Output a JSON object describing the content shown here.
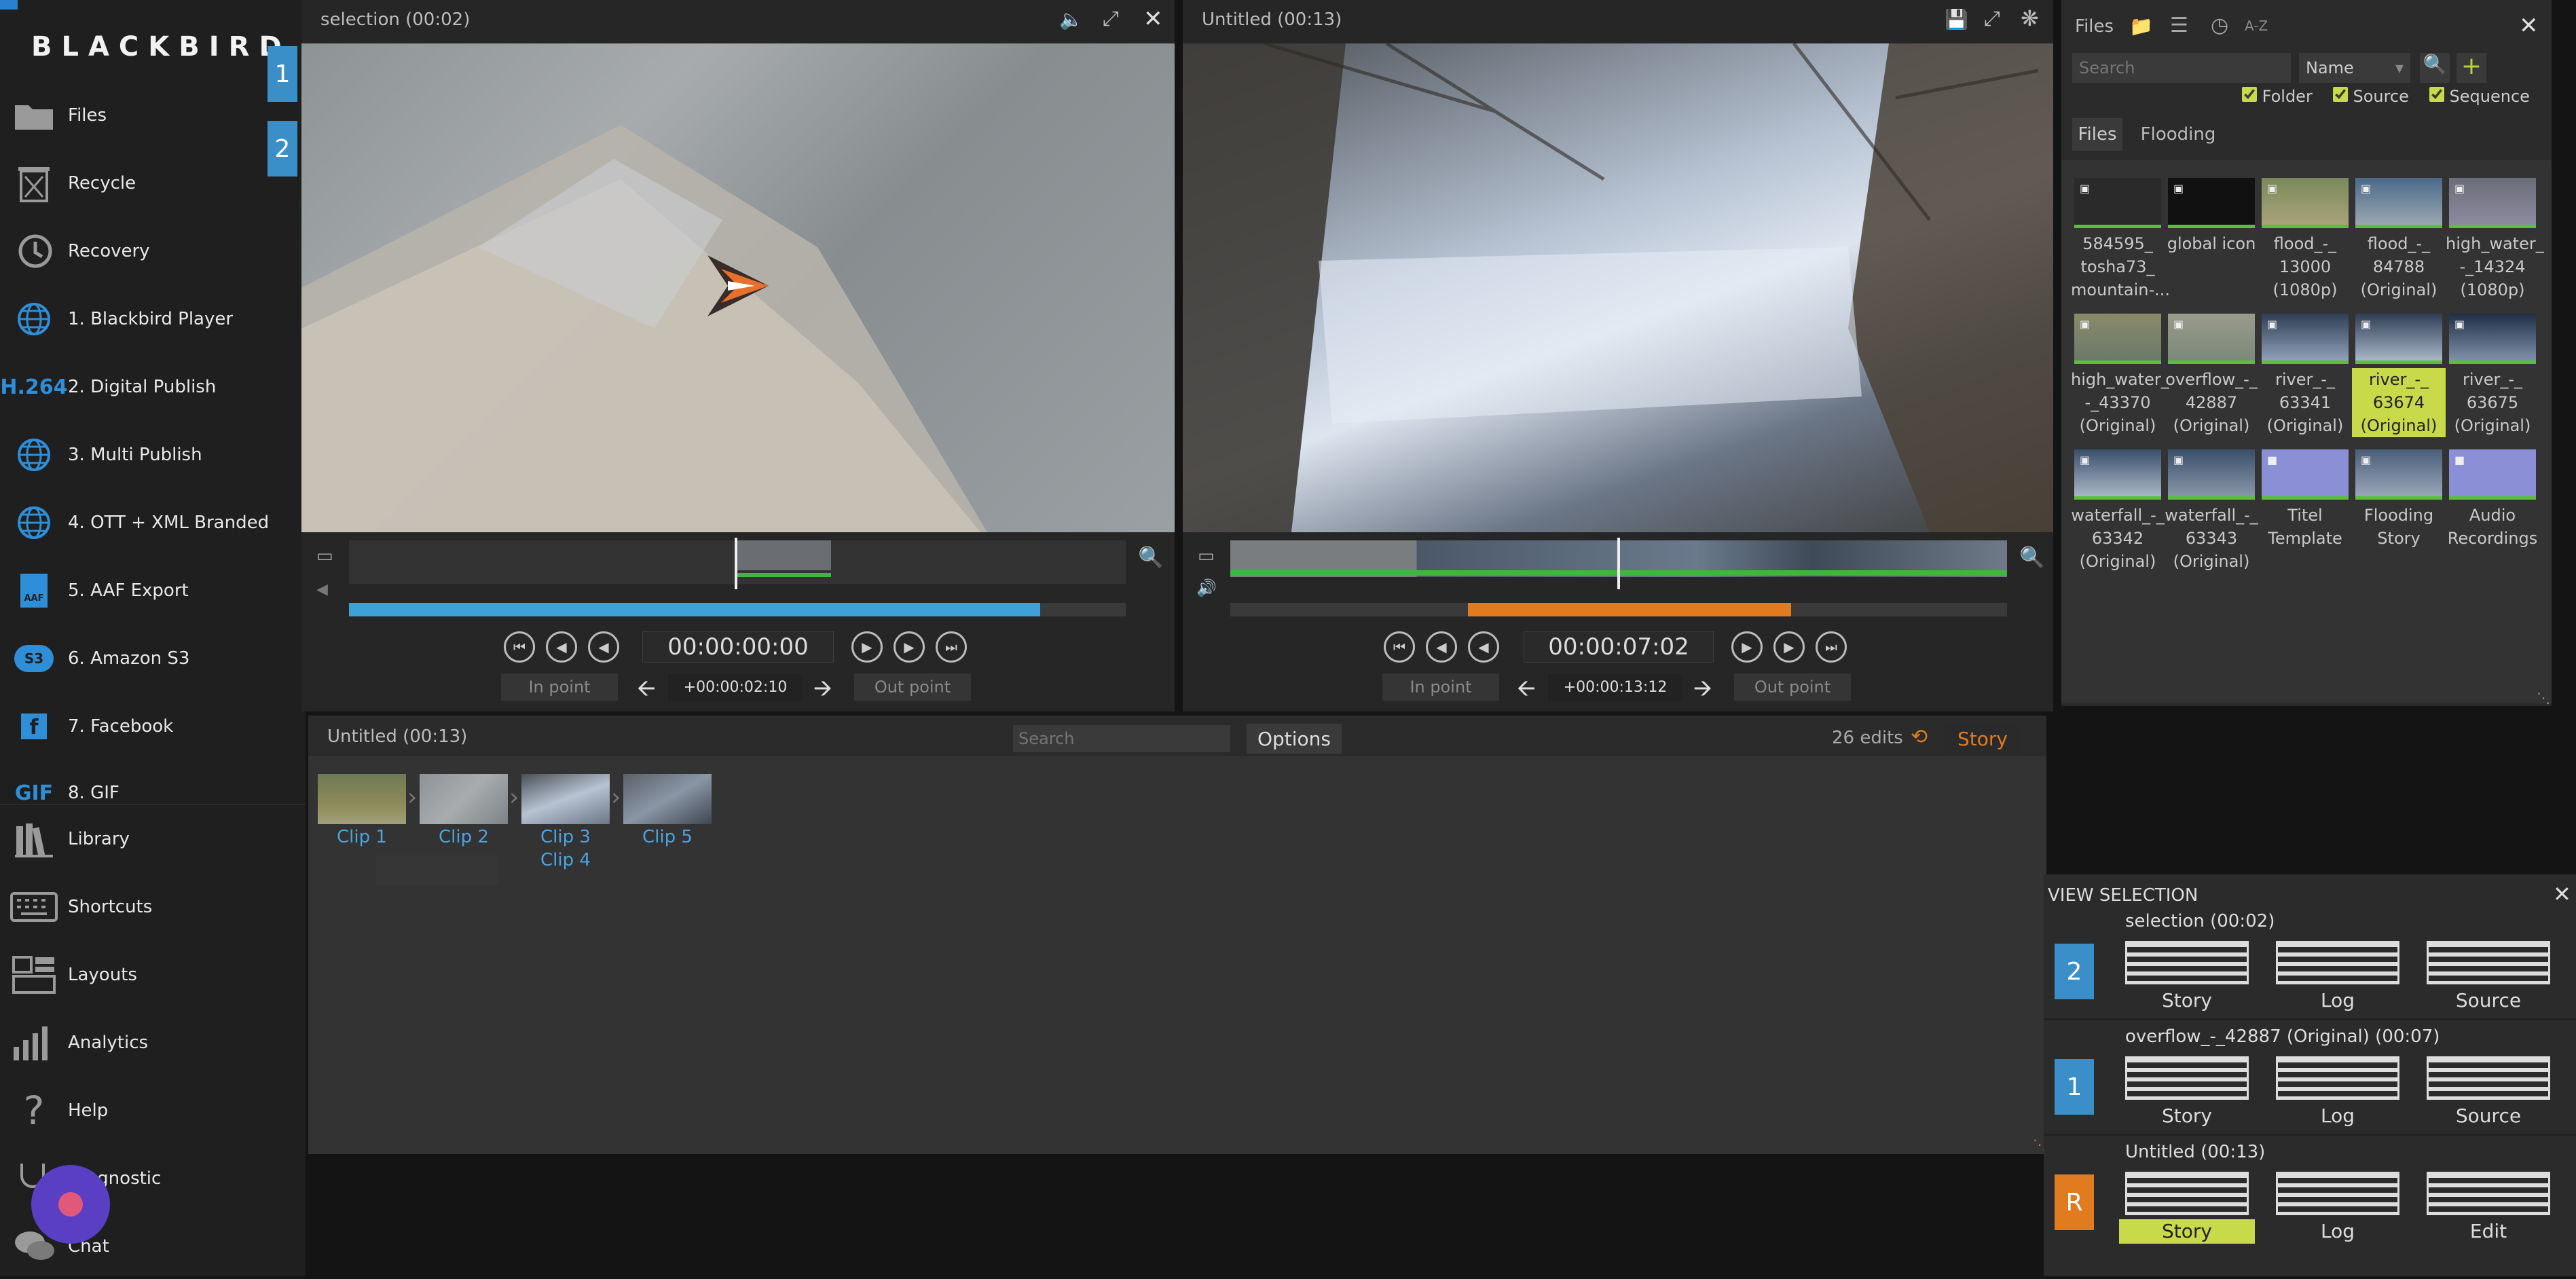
{
  "app": {
    "brand": "BLACKBIRD"
  },
  "sidebar": {
    "badges": [
      "1",
      "2"
    ],
    "items": [
      {
        "label": "Files",
        "icon": "folder-icon"
      },
      {
        "label": "Recycle",
        "icon": "recycle-bin-icon"
      },
      {
        "label": "Recovery",
        "icon": "history-icon"
      },
      {
        "label": "1. Blackbird Player",
        "icon": "globe-icon"
      },
      {
        "label": "2. Digital Publish",
        "icon": "h264-icon",
        "icon_text": "H.264"
      },
      {
        "label": "3. Multi Publish",
        "icon": "globe-icon"
      },
      {
        "label": "4. OTT + XML Branded",
        "icon": "globe-icon"
      },
      {
        "label": "5. AAF Export",
        "icon": "aaf-icon",
        "icon_text": "AAF"
      },
      {
        "label": "6. Amazon S3",
        "icon": "s3-icon",
        "icon_text": "S3"
      },
      {
        "label": "7. Facebook",
        "icon": "facebook-icon",
        "icon_text": "f"
      },
      {
        "label": "8. GIF",
        "icon": "gif-icon",
        "icon_text": "GIF"
      },
      {
        "label": "Library",
        "icon": "library-icon"
      },
      {
        "label": "Shortcuts",
        "icon": "keyboard-icon"
      },
      {
        "label": "Layouts",
        "icon": "layouts-icon"
      },
      {
        "label": "Analytics",
        "icon": "analytics-icon"
      },
      {
        "label": "Help",
        "icon": "help-icon"
      },
      {
        "label": "Diagnostic",
        "icon": "diagnostic-icon"
      },
      {
        "label": "Chat",
        "icon": "chat-icon"
      }
    ]
  },
  "viewer_left": {
    "title": "selection (00:02)",
    "timecode": "00:00:00:00",
    "in_label": "In point",
    "out_label": "Out point",
    "duration": "+00:00:02:10",
    "progress": 0.89
  },
  "viewer_right": {
    "title": "Untitled (00:13)",
    "timecode": "00:00:07:02",
    "in_label": "In point",
    "out_label": "Out point",
    "duration": "+00:00:13:12"
  },
  "files_panel": {
    "title": "Files",
    "sort_label": "A-Z",
    "search_placeholder": "Search",
    "sort_select": "Name",
    "filters": [
      {
        "label": "Folder",
        "checked": true
      },
      {
        "label": "Source",
        "checked": true
      },
      {
        "label": "Sequence",
        "checked": true
      }
    ],
    "tabs": [
      "Files",
      "Flooding"
    ],
    "items": [
      {
        "line1": "584595_",
        "line2": "tosha73_",
        "line3": "mountain-..."
      },
      {
        "line1": "global icon",
        "line2": "",
        "line3": ""
      },
      {
        "line1": "flood_-_",
        "line2": "13000",
        "line3": "(1080p)"
      },
      {
        "line1": "flood_-_",
        "line2": "84788",
        "line3": "(Original)"
      },
      {
        "line1": "high_water_",
        "line2": "-_14324",
        "line3": "(1080p)"
      },
      {
        "line1": "high_water_",
        "line2": "-_43370",
        "line3": "(Original)"
      },
      {
        "line1": "overflow_-_",
        "line2": "42887",
        "line3": "(Original)"
      },
      {
        "line1": "river_-_",
        "line2": "63341",
        "line3": "(Original)"
      },
      {
        "line1": "river_-_",
        "line2": "63674",
        "line3": "(Original)",
        "selected": true
      },
      {
        "line1": "river_-_",
        "line2": "63675",
        "line3": "(Original)"
      },
      {
        "line1": "waterfall_-_",
        "line2": "63342",
        "line3": "(Original)"
      },
      {
        "line1": "waterfall_-_",
        "line2": "63343",
        "line3": "(Original)"
      },
      {
        "line1": "Titel",
        "line2": "Template",
        "line3": "",
        "folder": true
      },
      {
        "line1": "Flooding",
        "line2": "Story",
        "line3": ""
      },
      {
        "line1": "Audio",
        "line2": "Recordings",
        "line3": "",
        "folder": true
      }
    ]
  },
  "storyboard": {
    "title": "Untitled (00:13)",
    "search_placeholder": "Search",
    "options_label": "Options",
    "edits": "26 edits",
    "story_label": "Story",
    "clips": [
      "Clip 1",
      "Clip 2",
      "Clip 3",
      "Clip 4",
      "Clip 5"
    ]
  },
  "view_selection": {
    "title": "VIEW SELECTION",
    "rows": [
      {
        "badge": "2",
        "name": "selection (00:02)",
        "views": [
          "Story",
          "Log",
          "Source"
        ]
      },
      {
        "badge": "1",
        "name": "overflow_-_42887 (Original) (00:07)",
        "views": [
          "Story",
          "Log",
          "Source"
        ]
      },
      {
        "badge": "R",
        "name": "Untitled (00:13)",
        "views": [
          "Story",
          "Log",
          "Edit"
        ]
      }
    ]
  },
  "colors": {
    "accent_blue": "#3b8fc9",
    "accent_orange": "#e07b1f",
    "highlight_yellow": "#c8d94a",
    "green": "#5bbf3a"
  }
}
